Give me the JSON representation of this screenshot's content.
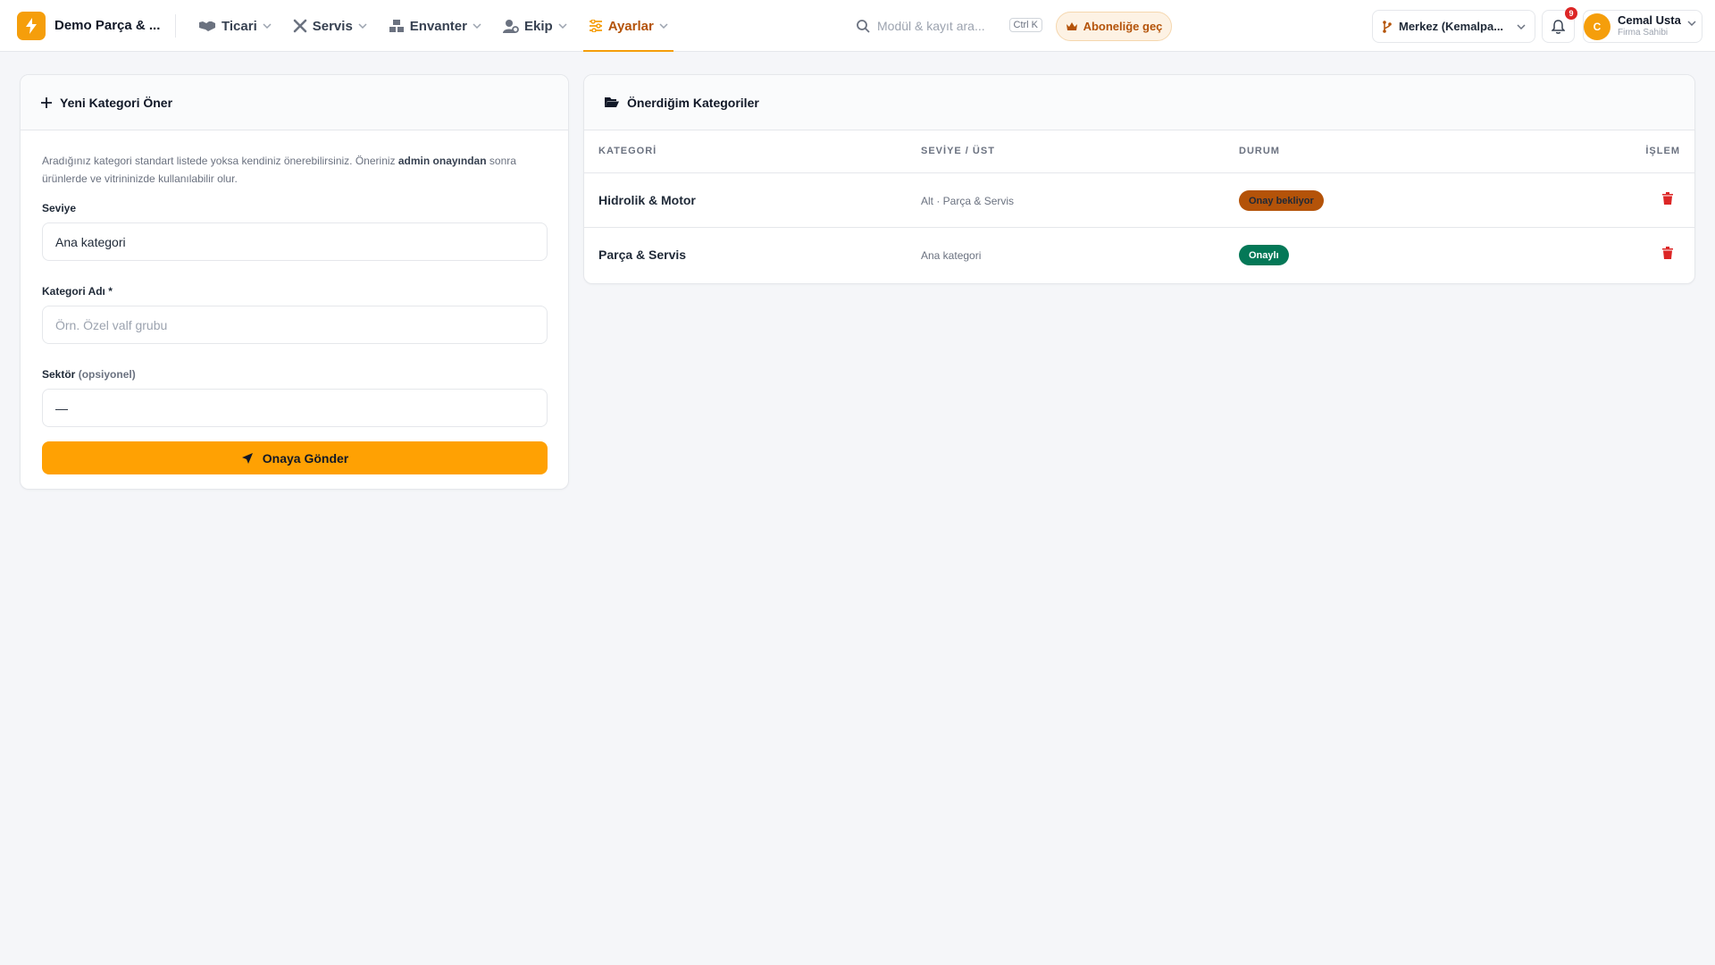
{
  "brand": {
    "name": "Demo Parça & ..."
  },
  "nav": [
    {
      "label": "Ticari",
      "icon": "handshake-icon"
    },
    {
      "label": "Servis",
      "icon": "tools-icon"
    },
    {
      "label": "Envanter",
      "icon": "boxes-icon"
    },
    {
      "label": "Ekip",
      "icon": "user-gear-icon"
    },
    {
      "label": "Ayarlar",
      "icon": "sliders-icon",
      "active": true
    }
  ],
  "search": {
    "placeholder": "Modül & kayıt ara...",
    "shortcut": "Ctrl K"
  },
  "subscribe": {
    "label": "Aboneliğe geç"
  },
  "branch": {
    "label": "Merkez (Kemalpa..."
  },
  "notifications": {
    "count": "9"
  },
  "user": {
    "initial": "C",
    "name": "Cemal Usta",
    "role": "Firma Sahibi"
  },
  "form": {
    "title": "Yeni Kategori Öner",
    "hint_before": "Aradığınız kategori standart listede yoksa kendiniz önerebilirsiniz. Öneriniz ",
    "hint_bold": "admin onayından",
    "hint_after": " sonra ürünlerde ve vitrininizde kullanılabilir olur.",
    "level_label": "Seviye",
    "level_value": "Ana kategori",
    "name_label": "Kategori Adı *",
    "name_placeholder": "Örn. Özel valf grubu",
    "sector_label": "Sektör",
    "sector_optional": "(opsiyonel)",
    "sector_value": "—",
    "submit_label": "Onaya Gönder"
  },
  "list": {
    "title": "Önerdiğim Kategoriler",
    "columns": {
      "category": "KATEGORİ",
      "level": "SEVİYE / ÜST",
      "status": "DURUM",
      "action": "İŞLEM"
    },
    "rows": [
      {
        "name": "Hidrolik & Motor",
        "level": "Alt · Parça & Servis",
        "status": "Onay bekliyor",
        "status_type": "pending"
      },
      {
        "name": "Parça & Servis",
        "level": "Ana kategori",
        "status": "Onaylı",
        "status_type": "approved"
      }
    ]
  },
  "colors": {
    "accent": "#f59e0b",
    "button": "#ffa103",
    "pending": "#b45309",
    "approved": "#047857",
    "danger": "#dc2626"
  }
}
